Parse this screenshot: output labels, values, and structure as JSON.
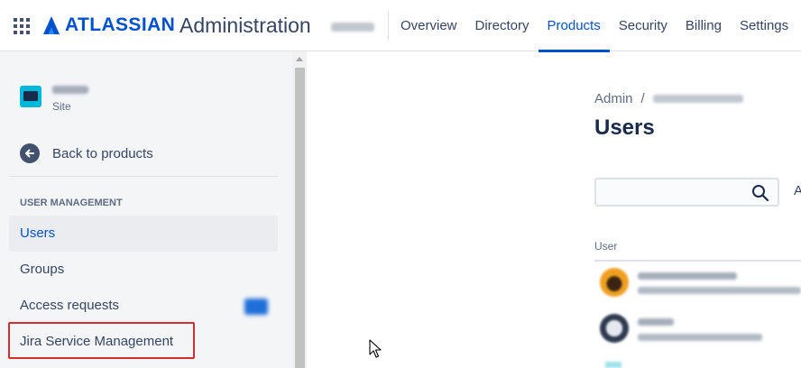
{
  "header": {
    "brand": "ATLASSIAN",
    "product": "Administration",
    "nav_tabs": [
      {
        "label": "Overview"
      },
      {
        "label": "Directory"
      },
      {
        "label": "Products",
        "active": true
      },
      {
        "label": "Security"
      },
      {
        "label": "Billing"
      },
      {
        "label": "Settings"
      }
    ]
  },
  "sidebar": {
    "site_label": "Site",
    "back_label": "Back to products",
    "section_heading": "USER MANAGEMENT",
    "items": [
      {
        "label": "Users",
        "active": true
      },
      {
        "label": "Groups"
      },
      {
        "label": "Access requests"
      },
      {
        "label": "Jira Service Management",
        "highlighted": true
      }
    ]
  },
  "main": {
    "breadcrumb_root": "Admin",
    "breadcrumb_sep": "/",
    "title": "Users",
    "search": {
      "value": "",
      "placeholder": ""
    },
    "filter_partial": "A",
    "column_header": "User"
  },
  "colors": {
    "accent": "#0052CC",
    "highlight_box": "#D32F2F",
    "sidebar_bg": "#F4F5F7"
  }
}
